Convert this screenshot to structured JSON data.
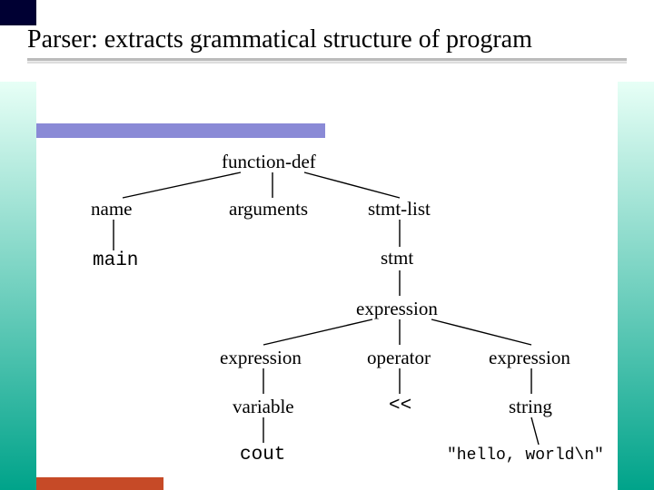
{
  "title": "Parser: extracts grammatical structure of program",
  "tree": {
    "function_def": "function-def",
    "name": "name",
    "arguments": "arguments",
    "stmt_list": "stmt-list",
    "main": "main",
    "stmt": "stmt",
    "expression_top": "expression",
    "expression_left": "expression",
    "operator": "operator",
    "expression_right": "expression",
    "variable": "variable",
    "op_symbol": "<<",
    "string_node": "string",
    "cout": "cout",
    "hello": "\"hello, world\\n\""
  }
}
